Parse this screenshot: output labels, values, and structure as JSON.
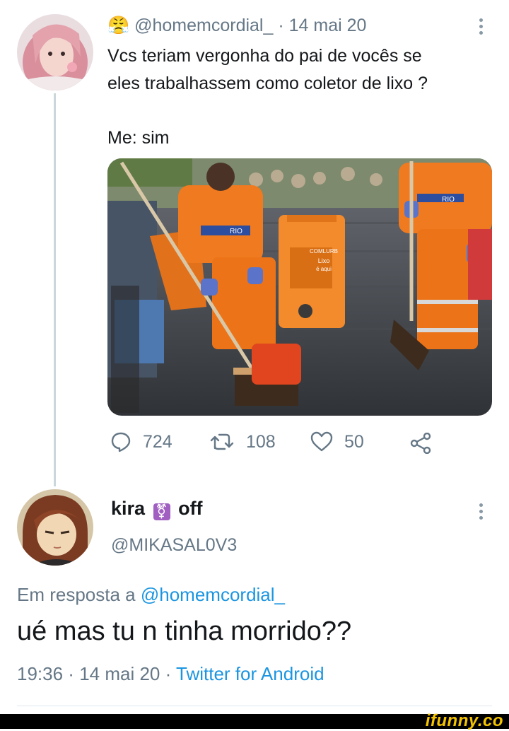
{
  "tweet": {
    "emoji": "😤",
    "handle": "@homemcordial_",
    "separator": " · ",
    "date": "14 mai 20",
    "line1": "Vcs teriam vergonha do pai de vocês se",
    "line2": "eles trabalhassem como coletor de lixo ?",
    "line3": "Me: sim",
    "photo_signs": {
      "bin_text_1": "COMLURB",
      "bin_text_2": "Lixo",
      "bin_text_3": "é aqui",
      "vest_text": "RIO"
    },
    "actions": {
      "replies": "724",
      "retweets": "108",
      "likes": "50"
    }
  },
  "reply": {
    "name_part1": "kira",
    "name_emoji": "⚧",
    "name_part2": "off",
    "handle": "@MIKASAL0V3",
    "replying_prefix": "Em resposta a ",
    "replying_to": "@homemcordial_",
    "text": "ué mas tu n tinha morrido??",
    "time": "19:36",
    "dot1": " · ",
    "date": "14 mai 20",
    "dot2": " · ",
    "client": "Twitter for Android"
  },
  "watermark": {
    "brand": "ifunny.co"
  },
  "colors": {
    "accent": "#1b95e0",
    "muted": "#657786",
    "orange_uniform": "#f07a1f",
    "divider": "#e1e8ed"
  }
}
